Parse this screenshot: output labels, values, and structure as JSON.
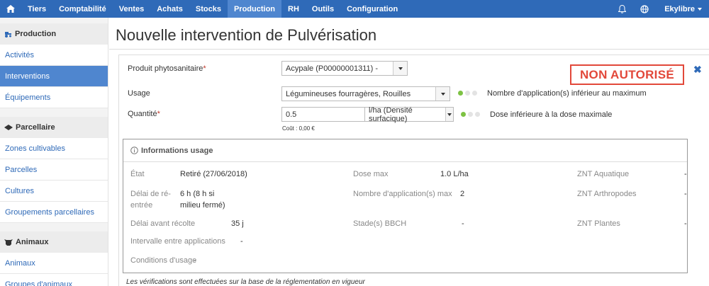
{
  "nav": {
    "items": [
      "Tiers",
      "Comptabilité",
      "Ventes",
      "Achats",
      "Stocks",
      "Production",
      "RH",
      "Outils",
      "Configuration"
    ],
    "active": "Production",
    "user": "Ekylibre"
  },
  "sidebar": {
    "sections": [
      {
        "title": "Production",
        "items": [
          "Activités",
          "Interventions",
          "Équipements"
        ]
      },
      {
        "title": "Parcellaire",
        "items": [
          "Zones cultivables",
          "Parcelles",
          "Cultures",
          "Groupements parcellaires"
        ]
      },
      {
        "title": "Animaux",
        "items": [
          "Animaux",
          "Groupes d'animaux"
        ]
      }
    ],
    "active_item": "Interventions"
  },
  "page": {
    "title": "Nouvelle intervention de Pulvérisation",
    "badge": "NON AUTORISÉ",
    "close": "✖"
  },
  "form": {
    "product_label": "Produit phytosanitaire",
    "product_value": "Acypale (P00000001311) -",
    "usage_label": "Usage",
    "usage_value": "Légumineuses fourragères, Rouilles",
    "usage_check": "Nombre d'application(s) inférieur au maximum",
    "quantity_label": "Quantité",
    "quantity_value": "0.5",
    "quantity_unit": "l/ha (Densité surfacique)",
    "quantity_check": "Dose inférieure à la dose maximale",
    "cost": "Coût : 0,00 €",
    "required": "*"
  },
  "info": {
    "title": "Informations usage",
    "etat_label": "État",
    "etat_value": "Retiré (27/06/2018)",
    "delai_reentree_label": "Délai de ré-entrée",
    "delai_reentree_value": "6 h (8 h si milieu fermé)",
    "delai_recolte_label": "Délai avant récolte",
    "delai_recolte_value": "35 j",
    "intervalle_label": "Intervalle entre applications",
    "intervalle_value": "-",
    "conditions_label": "Conditions d'usage",
    "conditions_value": "-",
    "dose_max_label": "Dose max",
    "dose_max_value": "1.0 L/ha",
    "nb_app_label": "Nombre d'application(s) max",
    "nb_app_value": "2",
    "bbch_label": "Stade(s) BBCH",
    "bbch_value": "-",
    "znt_aqua_label": "ZNT Aquatique",
    "znt_aqua_value": "-",
    "znt_arthro_label": "ZNT Arthropodes",
    "znt_arthro_value": "-",
    "znt_plantes_label": "ZNT Plantes",
    "znt_plantes_value": "-"
  },
  "footer_note": "Les vérifications sont effectuées sur la base de la réglementation en vigueur",
  "colors": {
    "nav": "#2f6ab8",
    "nav_active": "#4f86cf",
    "badge": "#e2483a",
    "check_ok": "#7dc243"
  },
  "icons": [
    "home-icon",
    "bell-icon",
    "globe-icon",
    "tractor-icon",
    "field-icon",
    "cow-icon",
    "info-icon",
    "close-icon"
  ]
}
